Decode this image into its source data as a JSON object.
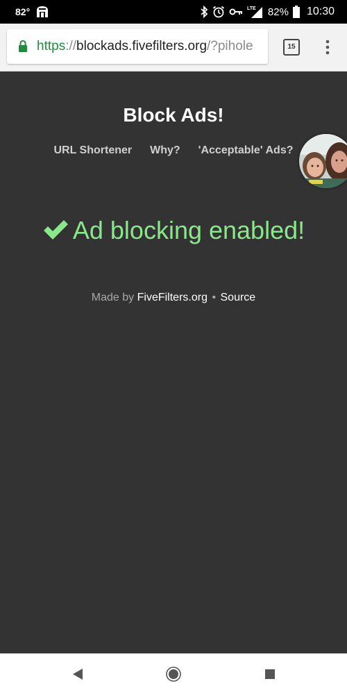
{
  "status_bar": {
    "temperature": "82°",
    "battery_percent": "82%",
    "time": "10:30",
    "network": "LTE",
    "icons": [
      "notification-icon",
      "bluetooth-icon",
      "alarm-icon",
      "vpn-key-icon",
      "signal-icon",
      "battery-icon"
    ]
  },
  "browser": {
    "url_scheme": "https",
    "url_separator": "://",
    "url_host": "blockads.fivefilters.org",
    "url_query": "/?pihole",
    "tab_count": "15",
    "secure": true
  },
  "page": {
    "title": "Block Ads!",
    "nav": {
      "url_shortener": "URL Shortener",
      "why": "Why?",
      "acceptable_ads": "'Acceptable' Ads?"
    },
    "status_message": "Ad blocking enabled!",
    "footer": {
      "made_by": "Made by",
      "fivefilters": "FiveFilters.org",
      "separator": "•",
      "source": "Source"
    }
  },
  "colors": {
    "page_background": "#333333",
    "status_green": "#89e889",
    "url_scheme_green": "#1e8e3e"
  }
}
